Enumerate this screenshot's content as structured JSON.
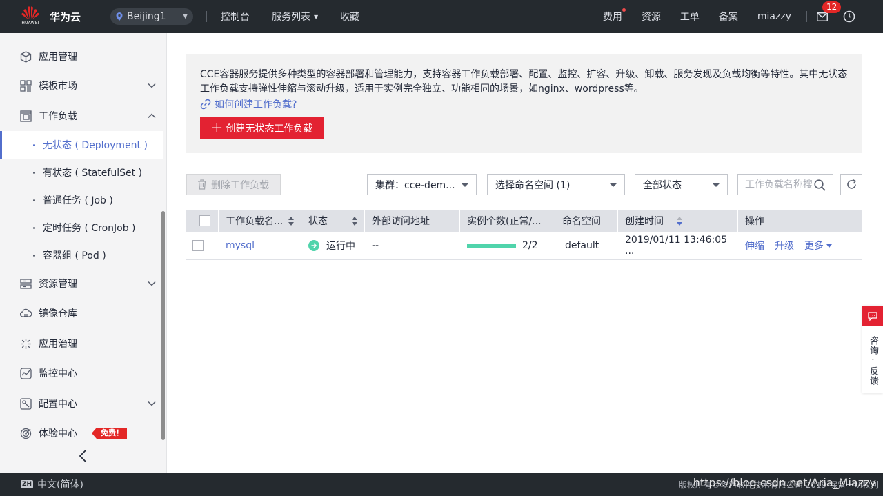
{
  "topbar": {
    "logo_sub": "HUAWEI",
    "brand": "华为云",
    "region": "Beijing1",
    "nav": [
      "控制台",
      "服务列表",
      "收藏"
    ],
    "right": {
      "fee": "费用",
      "resource": "资源",
      "ticket": "工单",
      "filing": "备案",
      "user": "miazzy"
    },
    "mail_count": "12"
  },
  "sidebar": {
    "items": [
      {
        "label": "应用管理",
        "icon": "cube-icon"
      },
      {
        "label": "模板市场",
        "icon": "grid-icon"
      },
      {
        "label": "工作负载",
        "icon": "workload-icon"
      },
      {
        "label": "资源管理",
        "icon": "server-icon"
      },
      {
        "label": "镜像仓库",
        "icon": "cloud-icon"
      },
      {
        "label": "应用治理",
        "icon": "sparkle-icon"
      },
      {
        "label": "监控中心",
        "icon": "monitor-icon"
      },
      {
        "label": "配置中心",
        "icon": "config-icon"
      },
      {
        "label": "体验中心",
        "icon": "target-icon"
      }
    ],
    "subitems": [
      "无状态 ( Deployment )",
      "有状态 ( StatefulSet )",
      "普通任务 ( Job )",
      "定时任务 ( CronJob )",
      "容器组 ( Pod )"
    ],
    "free_badge": "免费！"
  },
  "intro": {
    "text": "CCE容器服务提供多种类型的容器部署和管理能力，支持容器工作负载部署、配置、监控、扩容、升级、卸载、服务发现及负载均衡等特性。其中无状态工作负载支持弹性伸缩与滚动升级，适用于实例完全独立、功能相同的场景，如nginx、wordpress等。",
    "help_link": "如何创建工作负载?",
    "create_button": "创建无状态工作负载"
  },
  "toolbar": {
    "delete_button": "删除工作负载",
    "cluster_select": "集群：cce-dem...",
    "namespace_select": "选择命名空间 (1)",
    "status_select": "全部状态",
    "search_placeholder": "工作负载名称搜索"
  },
  "table": {
    "headers": [
      "工作负载名...",
      "状态",
      "外部访问地址",
      "实例个数(正常/...",
      "命名空间",
      "创建时间",
      "操作"
    ],
    "rows": [
      {
        "name": "mysql",
        "status": "运行中",
        "external": "--",
        "instances": "2/2",
        "instances_ratio": 1.0,
        "namespace": "default",
        "created": "2019/01/11 13:46:05 ...",
        "ops": [
          "伸缩",
          "升级",
          "更多"
        ]
      }
    ]
  },
  "feedback": {
    "label": "咨询·反馈"
  },
  "footer": {
    "lang": "中文(简体)",
    "lang_icon": "ZH",
    "copyright": "版权所有©华为软件技术有限公司 2019 保留一切权利",
    "watermark": "https://blog.csdn.net/Aria_Miazzy"
  },
  "colors": {
    "accent": "#526ecc",
    "danger": "#e32232",
    "success": "#50d4ab",
    "topbar": "#252a2f"
  }
}
